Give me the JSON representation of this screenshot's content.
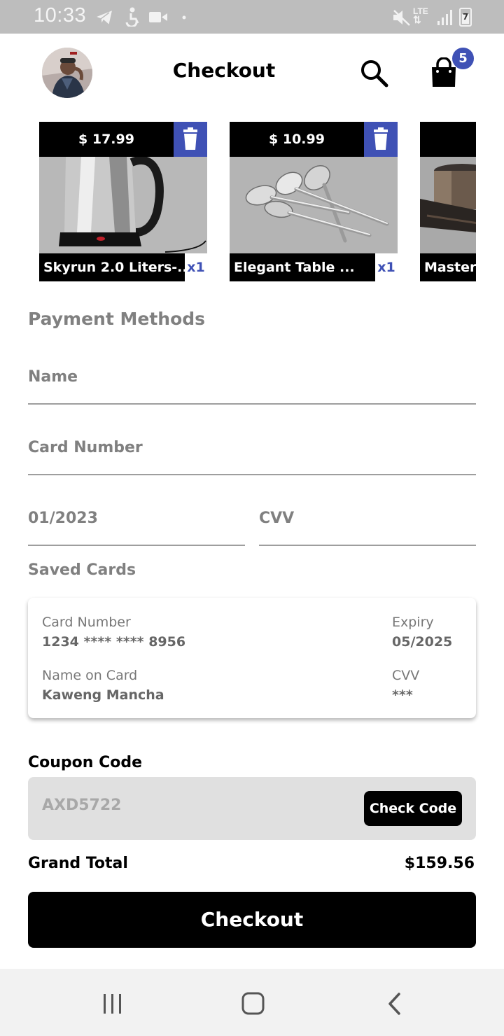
{
  "status_bar": {
    "time": "10:33",
    "network": "LTE",
    "battery_level": "7",
    "icons": [
      "telegram-icon",
      "accessibility-icon",
      "video-icon",
      "dot-icon",
      "mute-icon",
      "lte-icon",
      "signal-icon",
      "battery-icon"
    ]
  },
  "header": {
    "title": "Checkout",
    "cart_count": "5",
    "icons": [
      "avatar",
      "search-icon",
      "shopping-bag-icon"
    ]
  },
  "products": [
    {
      "price": "$ 17.99",
      "name": "Skyrun 2.0 Liters-...",
      "qty": "x1",
      "image": "electric-kettle"
    },
    {
      "price": "$ 10.99",
      "name": "Elegant Table ...",
      "qty": "x1",
      "image": "spoons"
    },
    {
      "price": "$ ",
      "name": "Master",
      "qty": "",
      "image": "cookware"
    }
  ],
  "payment": {
    "title": "Payment Methods",
    "name_placeholder": "Name",
    "card_number_placeholder": "Card Number",
    "expiry_value": "01/2023",
    "cvv_placeholder": "CVV"
  },
  "saved_cards": {
    "title": "Saved Cards",
    "card": {
      "card_number_label": "Card Number",
      "card_number": "1234 **** **** 8956",
      "expiry_label": "Expiry",
      "expiry": "05/2025",
      "name_label": "Name on Card",
      "name": "Kaweng Mancha",
      "cvv_label": "CVV",
      "cvv": "***"
    }
  },
  "coupon": {
    "label": "Coupon Code",
    "placeholder": "AXD5722",
    "button": "Check Code"
  },
  "total": {
    "label": "Grand Total",
    "value": "$159.56"
  },
  "checkout_button": "Checkout",
  "colors": {
    "accent": "#3f51b5",
    "primary": "#000000",
    "muted_text": "#808080",
    "status_bar": "#bdbdbd"
  }
}
